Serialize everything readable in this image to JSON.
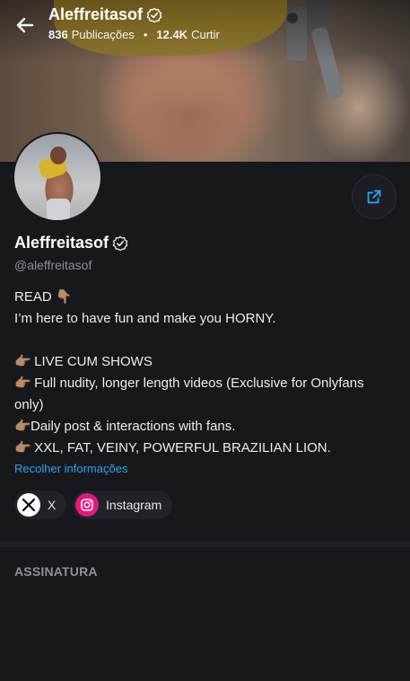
{
  "profile": {
    "name": "Aleffreitasof",
    "handle": "@aleffreitasof",
    "posts_count": "836",
    "posts_label": "Publicações",
    "likes_count": "12.4K",
    "likes_label": "Curtir",
    "separator": "•"
  },
  "bio": {
    "line1": "READ 👇🏽",
    "line2": "I’m here to have fun and make you HORNY.",
    "items": [
      {
        "emoji": "👉🏽",
        "text": " LIVE CUM SHOWS"
      },
      {
        "emoji": "👉🏽",
        "text": " Full nudity, longer length videos (Exclusive for Onlyfans only)"
      },
      {
        "emoji": "👉🏽",
        "text": "Daily post & interactions with fans."
      },
      {
        "emoji": "👉🏽",
        "text": " XXL, FAT, VEINY, POWERFUL BRAZILIAN LION."
      }
    ],
    "collapse_label": "Recolher informações"
  },
  "social_links": [
    {
      "label": "X",
      "icon": "x-logo-icon"
    },
    {
      "label": "Instagram",
      "icon": "instagram-icon"
    }
  ],
  "section": {
    "title": "ASSINATURA"
  },
  "colors": {
    "background": "#17181c",
    "accent_link": "#2ea3f2",
    "instagram": "#e4187a"
  }
}
